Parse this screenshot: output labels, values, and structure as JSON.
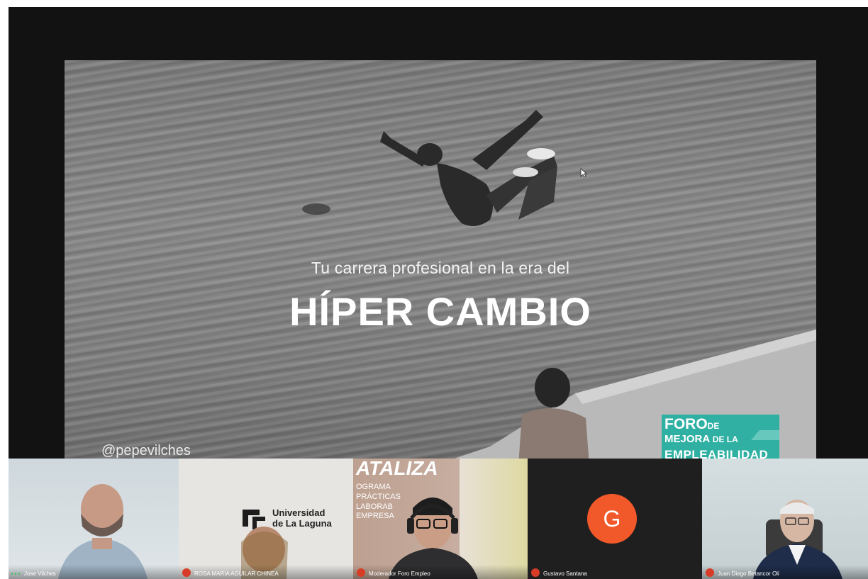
{
  "slide": {
    "subtitle": "Tu carrera profesional en la era del",
    "title": "HÍPER CAMBIO",
    "handle": "@pepevilches",
    "logo": {
      "line1_big": "FORO",
      "line1_small": "DE",
      "line2_big": "MEJORA",
      "line2_small": "DE LA",
      "line3": "EMPLEABILIDAD"
    }
  },
  "participants": [
    {
      "name": "Jose Vilches",
      "status_icon": "more-dots-icon"
    },
    {
      "name": "ROSA MARIA AGUILAR CHINEA",
      "status_icon": "mic-off-icon",
      "background_text": [
        "Universidad",
        "de La Laguna"
      ]
    },
    {
      "name": "Moderador Foro Empleo",
      "status_icon": "mic-off-icon",
      "background_text": [
        "ATALIZA",
        "OGRAMA",
        "PRÁCTICAS",
        "LABORAB",
        "EMPRESA"
      ]
    },
    {
      "name": "Gustavo Santana",
      "status_icon": "mic-off-icon",
      "avatar_letter": "G"
    },
    {
      "name": "Juan Diego Betancor Oli",
      "status_icon": "mic-off-icon"
    }
  ],
  "colors": {
    "app_background": "#121212",
    "logo_teal": "#2fb0a3",
    "avatar_orange": "#f1592a",
    "mic_off_red": "#d83b26"
  }
}
